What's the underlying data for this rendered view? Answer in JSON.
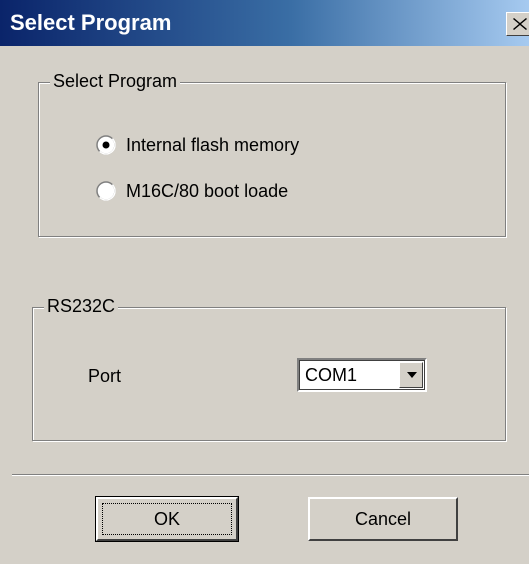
{
  "window": {
    "title": "Select Program",
    "close_icon": "close-icon"
  },
  "program_group": {
    "legend": "Select Program",
    "options": [
      {
        "label": "Internal flash memory",
        "selected": true
      },
      {
        "label": "M16C/80 boot loade",
        "selected": false
      }
    ]
  },
  "rs232c_group": {
    "legend": "RS232C",
    "port_label": "Port",
    "port_value": "COM1"
  },
  "buttons": {
    "ok_label": "OK",
    "cancel_label": "Cancel"
  },
  "colors": {
    "face": "#d4d0c8",
    "title_bar": "#0a246a",
    "title_text": "#ffffff"
  }
}
